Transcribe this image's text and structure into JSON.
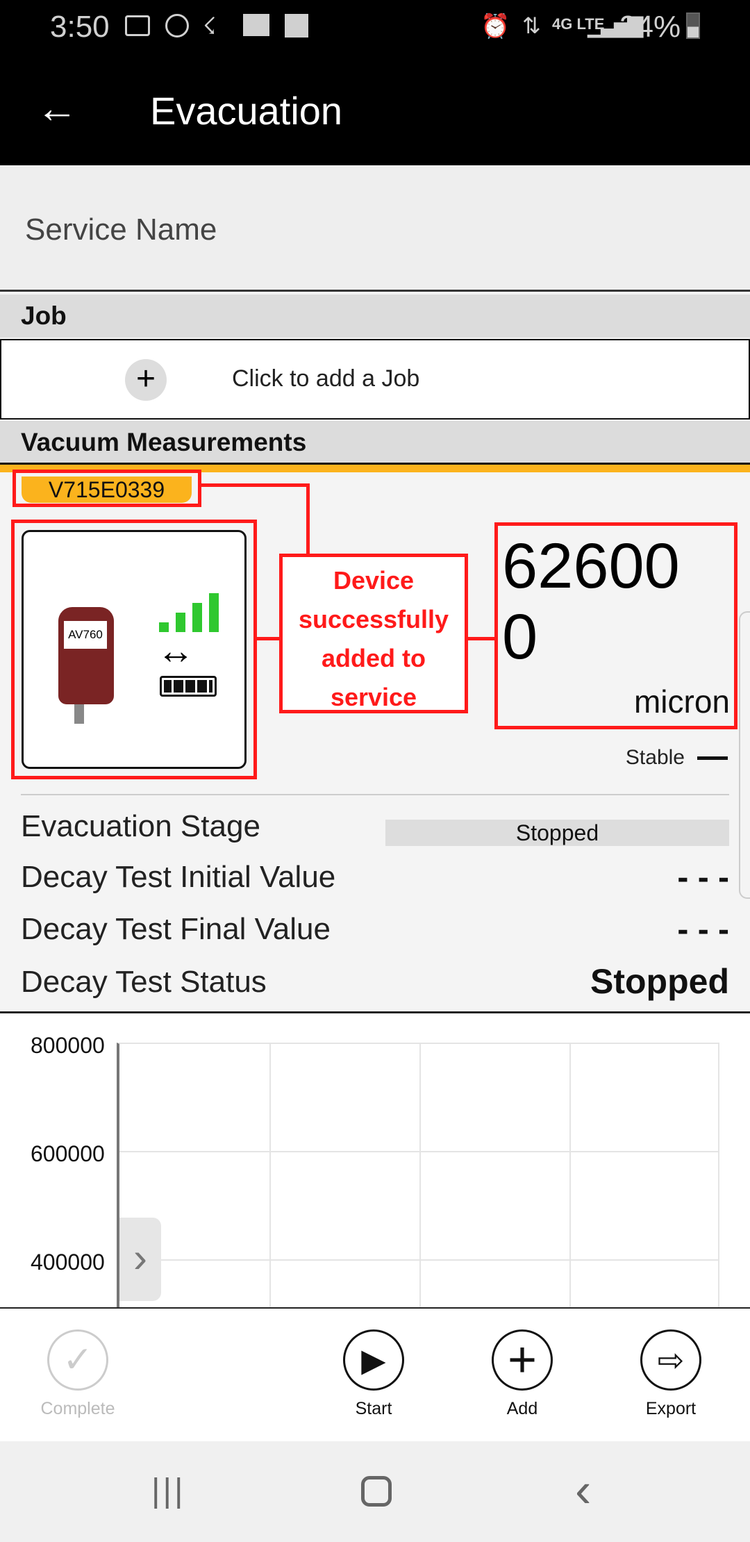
{
  "status_bar": {
    "time": "3:50",
    "battery": "34%",
    "network": "4G LTE"
  },
  "toolbar": {
    "title": "Evacuation"
  },
  "service": {
    "placeholder": "Service Name"
  },
  "job": {
    "header": "Job",
    "add_label": "Click to add a Job"
  },
  "vacuum": {
    "header": "Vacuum Measurements",
    "device_id": "V715E0339",
    "device_model": "AV760",
    "callout": "Device successfully added to service",
    "reading_value": "626000",
    "reading_line1": "62600",
    "reading_line2": "0",
    "unit": "micron",
    "stability": "Stable",
    "accent_color": "#fbb31d",
    "annotation_color": "#ff1a1a"
  },
  "details": [
    {
      "label": "Evacuation Stage",
      "value": "Stopped"
    },
    {
      "label": "Decay Test Initial Value",
      "value": "- - -"
    },
    {
      "label": "Decay Test Final Value",
      "value": "- - -"
    },
    {
      "label": "Decay Test Status",
      "value": "Stopped"
    }
  ],
  "chart_data": {
    "type": "line",
    "series": [],
    "y_ticks": [
      "800000",
      "600000",
      "400000"
    ],
    "grid": true
  },
  "bottom_bar": {
    "complete": "Complete",
    "start": "Start",
    "add": "Add",
    "export": "Export"
  }
}
